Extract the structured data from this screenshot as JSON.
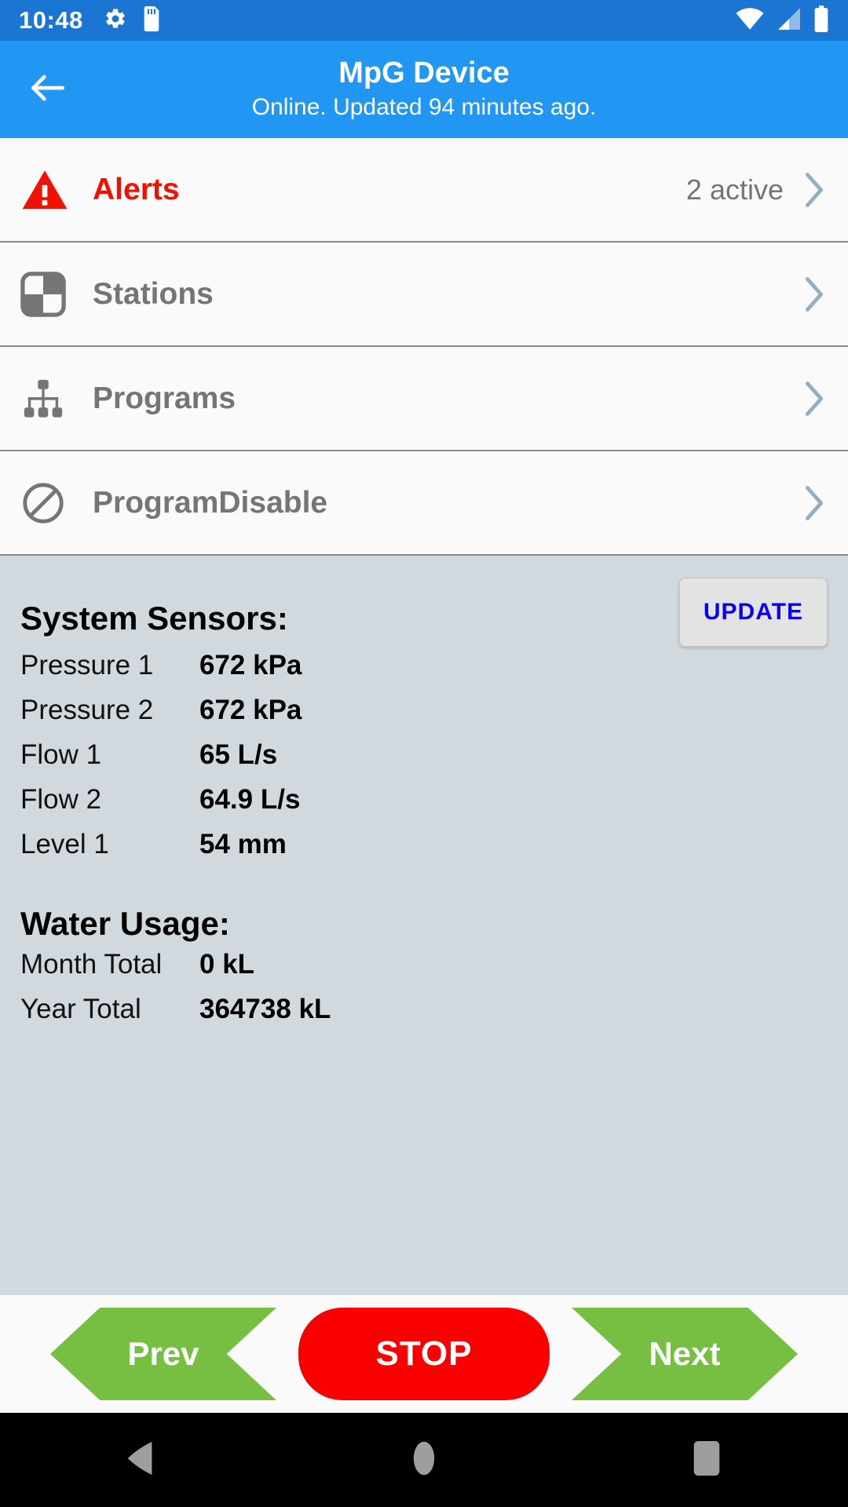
{
  "status_bar": {
    "time": "10:48",
    "left_icons": [
      "gear-icon",
      "sd-card-icon"
    ],
    "right_icons": [
      "wifi-icon",
      "cellular-signal-icon",
      "battery-icon"
    ],
    "background_color": "#1A76D2"
  },
  "app_bar": {
    "back_icon": "back-arrow-icon",
    "title": "MpG Device",
    "subtitle": "Online. Updated 94 minutes ago.",
    "background_color": "#2196F3"
  },
  "list": {
    "items": [
      {
        "icon": "warning-triangle-icon",
        "label": "Alerts",
        "value": "2 active",
        "color": "#F21000",
        "chevron": "chevron-right-icon"
      },
      {
        "icon": "checkerboard-icon",
        "label": "Stations",
        "value": "",
        "color": "#757575",
        "chevron": "chevron-right-icon"
      },
      {
        "icon": "sitemap-icon",
        "label": "Programs",
        "value": "",
        "color": "#757575",
        "chevron": "chevron-right-icon"
      },
      {
        "icon": "prohibition-icon",
        "label": "ProgramDisable",
        "value": "",
        "color": "#757575",
        "chevron": "chevron-right-icon"
      }
    ]
  },
  "panel": {
    "sensors_title": "System Sensors:",
    "update_label": "UPDATE",
    "update_color": "#0A00F5",
    "background_color": "#D2D9DE",
    "sensors": [
      {
        "key": "Pressure 1",
        "value": "672 kPa"
      },
      {
        "key": "Pressure 2",
        "value": "672 kPa"
      },
      {
        "key": "Flow 1",
        "value": "65 L/s"
      },
      {
        "key": "Flow 2",
        "value": "64.9 L/s"
      },
      {
        "key": "Level 1",
        "value": "54 mm"
      }
    ],
    "usage_title": "Water Usage:",
    "usage": [
      {
        "key": "Month Total",
        "value": "0 kL"
      },
      {
        "key": "Year Total",
        "value": "364738 kL"
      }
    ]
  },
  "buttons": {
    "prev_label": "Prev",
    "stop_label": "STOP",
    "next_label": "Next",
    "green": "#76BF43",
    "red": "#FA0000"
  },
  "nav_bar": {
    "back_icon": "nav-back-triangle-icon",
    "home_icon": "nav-home-circle-icon",
    "recents_icon": "nav-recents-square-icon"
  }
}
